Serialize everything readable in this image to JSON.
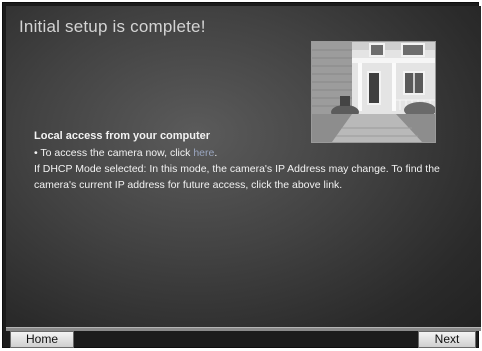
{
  "page": {
    "title": "Initial setup is complete!"
  },
  "local_access": {
    "heading": "Local access from your computer",
    "bullet_prefix": "• To access the camera now, click ",
    "link_text": "here",
    "bullet_suffix": ".",
    "dhcp_line1": "If DHCP Mode selected: In this mode, the camera's IP Address may change. To find the",
    "dhcp_line2": "camera's current IP address for future access, click the above link."
  },
  "buttons": {
    "home": "Home",
    "next": "Next"
  },
  "colors": {
    "background": "#1c1c1c",
    "title_text": "#d4d4d4",
    "body_text": "#f2f2f2",
    "link": "#9aa6c0"
  },
  "image": {
    "subject": "house-porch-photo"
  }
}
